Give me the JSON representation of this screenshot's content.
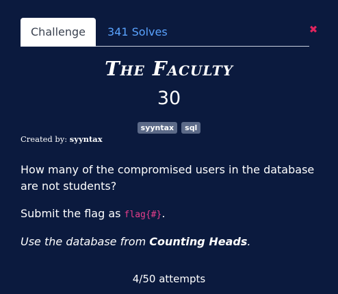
{
  "tabs": {
    "challenge_label": "Challenge",
    "solves_label": "341 Solves"
  },
  "close_icon": "close-x-icon",
  "challenge": {
    "name": "The Faculty",
    "value": "30",
    "tags": [
      "syyntax",
      "sql"
    ],
    "created_by_label": "Created by:",
    "author": "syyntax",
    "description_question": "How many of the compromised users in the database are not students?",
    "submit_prefix": "Submit the flag as ",
    "flag_format": "flag{#}",
    "submit_suffix": ".",
    "hint_prefix": "Use the database from ",
    "hint_bold": "Counting Heads",
    "hint_suffix": "."
  },
  "attempts": "4/50 attempts",
  "colors": {
    "background": "#0b1a3e",
    "link": "#5aa3ff",
    "close": "#e0245e",
    "code": "#e83e8c",
    "tag": "#5c6a88"
  }
}
